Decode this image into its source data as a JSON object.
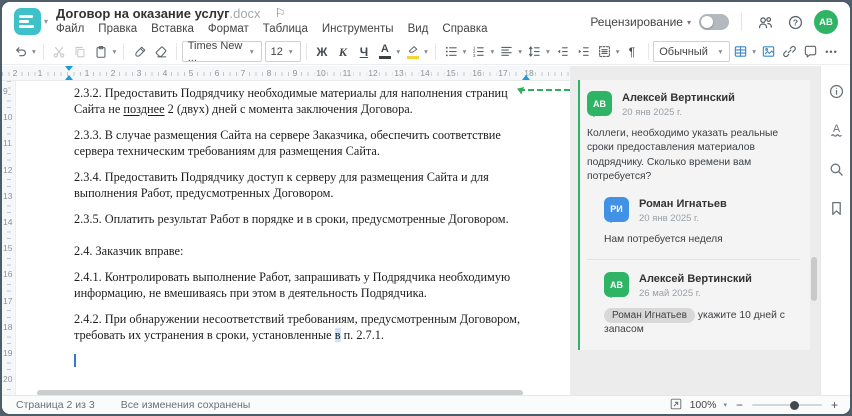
{
  "header": {
    "title": "Договор на оказание услуг",
    "title_ext": ".docx",
    "menu": [
      "Файл",
      "Правка",
      "Вставка",
      "Формат",
      "Таблица",
      "Инструменты",
      "Вид",
      "Справка"
    ],
    "review_label": "Рецензирование",
    "avatar_initials": "АВ"
  },
  "toolbar": {
    "font_name": "Times New ...",
    "font_size": "12",
    "bold": "Ж",
    "italic": "К",
    "underline": "Ч",
    "font_color_letter": "А",
    "pilcrow": "¶",
    "style_name": "Обычный",
    "more": "•••"
  },
  "ruler": {
    "left_numbers": [
      "2",
      "1"
    ],
    "numbers": [
      "1",
      "2",
      "3",
      "4",
      "5",
      "6",
      "7",
      "8",
      "9",
      "10",
      "11",
      "12",
      "13",
      "14",
      "15",
      "16",
      "17",
      "18"
    ]
  },
  "vruler": {
    "numbers": [
      "9",
      "10",
      "11",
      "12",
      "13",
      "14",
      "15",
      "16",
      "17",
      "18",
      "19",
      "20"
    ]
  },
  "document": {
    "paragraphs": [
      {
        "runs": [
          {
            "t": "2.3.2. Предоставить Подрядчику необходимые материалы для наполнения страниц Сайта не "
          },
          {
            "t": "позднее",
            "u": true
          },
          {
            "t": " 2 (двух) дней с момента заключения Договора."
          }
        ]
      },
      {
        "runs": [
          {
            "t": "2.3.3. В случае размещения Сайта на сервере Заказчика, обеспечить соответствие сервера техническим требованиям для размещения Сайта."
          }
        ]
      },
      {
        "runs": [
          {
            "t": "2.3.4. Предоставить Подрядчику доступ к серверу для размещения Сайта и для выполнения Работ, предусмотренных Договором."
          }
        ]
      },
      {
        "runs": [
          {
            "t": "2.3.5. Оплатить результат Работ в порядке и в сроки, предусмотренные Договором."
          }
        ]
      },
      {
        "space_before": true,
        "runs": [
          {
            "t": "2.4. Заказчик вправе:"
          }
        ]
      },
      {
        "runs": [
          {
            "t": "2.4.1. Контролировать выполнение Работ, запрашивать у Подрядчика необходимую информацию, не вмешиваясь при этом в деятельность Подрядчика."
          }
        ]
      },
      {
        "runs": [
          {
            "t": "2.4.2. При обнаружении несоответствий требованиям, предусмотренным Договором, требовать их устранения в сроки, установленные "
          },
          {
            "t": "в",
            "hl": true
          },
          {
            "t": " п. 2.7.1."
          }
        ]
      }
    ]
  },
  "comments": {
    "thread": [
      {
        "initials": "АВ",
        "color": "green",
        "name": "Алексей Вертинский",
        "date": "20 янв 2025 г.",
        "text": "Коллеги, необходимо указать реальные сроки предоставления материалов подрядчику. Сколько времени вам потребуется?",
        "reply": false
      },
      {
        "initials": "РИ",
        "color": "blue",
        "name": "Роман Игнатьев",
        "date": "20 янв 2025 г.",
        "text": "Нам потребуется неделя",
        "reply": true
      },
      {
        "initials": "АВ",
        "color": "green",
        "name": "Алексей Вертинский",
        "date": "26 май 2025 г.",
        "mention": "Роман Игнатьев",
        "text": "укажите 10 дней с запасом",
        "reply": true,
        "divider": true
      }
    ]
  },
  "statusbar": {
    "page_label": "Страница 2 из 3",
    "saved_label": "Все изменения сохранены",
    "zoom_value": "100%"
  },
  "colors": {
    "accent_teal": "#3fc1c9",
    "green": "#2eb464",
    "blue_avatar": "#4192e6",
    "marker_blue": "#1d9ad8"
  }
}
